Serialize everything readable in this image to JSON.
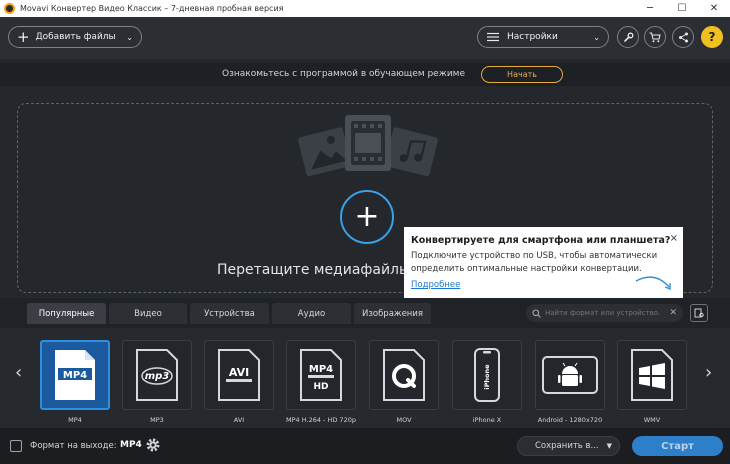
{
  "window": {
    "title": "Movavi Конвертер Видео Классик – 7-дневная пробная версия",
    "controls": [
      "─",
      "☐",
      "✕"
    ]
  },
  "toolbar": {
    "add_files_label": "Добавить файлы",
    "settings_label": "Настройки"
  },
  "tutorial": {
    "text": "Ознакомьтесь с программой в обучающем режиме",
    "button_label": "Начать",
    "accent": "#e6a93b"
  },
  "dropzone": {
    "text": "Перетащите медиафайлы"
  },
  "tip": {
    "title": "Конвертируете для смартфона или планшета?",
    "close": "×",
    "body": "Подключите устройство по USB, чтобы автоматически определить оптимальные настройки конвертации.",
    "link": "Подробнее"
  },
  "formats": {
    "tabs": [
      "Популярные",
      "Видео",
      "Устройства",
      "Аудио",
      "Изображения"
    ],
    "active_tab": "Популярные",
    "search_placeholder": "Найти формат или устройство...",
    "prev": "‹",
    "next": "›",
    "items": [
      {
        "label": "MP4",
        "icon": "mp4-icon",
        "badge": "MP4"
      },
      {
        "label": "MP3",
        "icon": "mp3-icon",
        "badge": "mp3"
      },
      {
        "label": "AVI",
        "icon": "avi-icon",
        "badge": "AVI"
      },
      {
        "label": "MP4 H.264 - HD 720p",
        "icon": "mp4-hd-icon",
        "badge": "MP4"
      },
      {
        "label": "MOV",
        "icon": "quicktime-icon",
        "badge": ""
      },
      {
        "label": "iPhone X",
        "icon": "iphone-icon",
        "badge": "iPhone"
      },
      {
        "label": "Android - 1280x720",
        "icon": "android-icon",
        "badge": ""
      },
      {
        "label": "WMV",
        "icon": "windows-icon",
        "badge": ""
      }
    ],
    "selected_index": 0
  },
  "bottom": {
    "output_label": "Формат на выходе:",
    "output_value": "MP4",
    "save_label": "Сохранить в...",
    "convert_label": "Старт",
    "accent": "#2e7fca"
  }
}
